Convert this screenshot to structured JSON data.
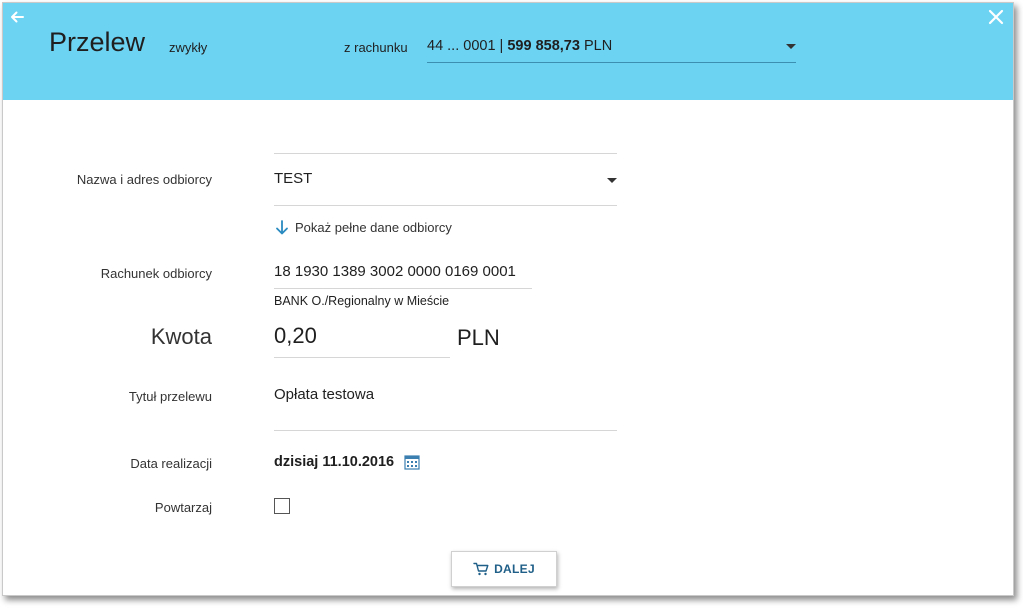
{
  "header": {
    "title": "Przelew",
    "subtitle": "zwykły",
    "from_account_label": "z rachunku",
    "from_account_number": "44 ... 0001 | ",
    "from_account_balance": "599 858,73",
    "from_account_currency": " PLN",
    "background_color": "#6dd3f3"
  },
  "icons": {
    "back": "arrow-left-icon",
    "close": "close-icon",
    "show_more": "arrow-down-icon",
    "calendar": "calendar-icon",
    "cart": "cart-icon"
  },
  "form": {
    "recipient_label": "Nazwa i adres odbiorcy",
    "recipient_value": "TEST",
    "show_full_recipient": "Pokaż pełne dane odbiorcy",
    "account_label": "Rachunek odbiorcy",
    "account_value": "18 1930 1389 3002 0000 0169 0001",
    "bank_name": "BANK O./Regionalny w Mieście",
    "amount_label": "Kwota",
    "amount_value": "0,20",
    "currency": "PLN",
    "transfer_title_label": "Tytuł przelewu",
    "transfer_title_value": "Opłata testowa",
    "date_label": "Data realizacji",
    "date_value": "dzisiaj 11.10.2016",
    "repeat_label": "Powtarzaj",
    "repeat_checked": false
  },
  "actions": {
    "next_label": "DALEJ"
  }
}
